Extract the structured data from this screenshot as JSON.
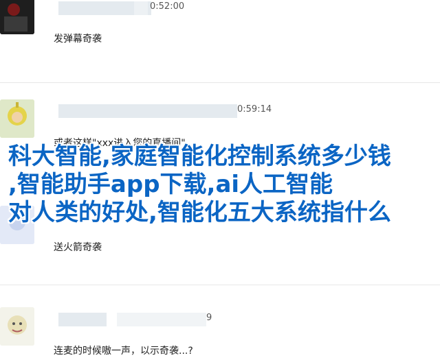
{
  "messages": [
    {
      "time": "0:52:00",
      "text": "发弹幕奇袭"
    },
    {
      "time": "0:59:14",
      "text": "或者这样\"xxx进入您的直播间\""
    },
    {
      "time": "",
      "text": "送火箭奇袭"
    },
    {
      "time": "9",
      "text": "连麦的时候嗷一声，以示奇袭...?"
    }
  ],
  "overlay": {
    "line1": "科大智能,家庭智能化控制系统多少钱",
    "line2": ",智能助手app下载,ai人工智能",
    "line3": "对人类的好处,智能化五大系统指什么"
  },
  "colors": {
    "overlay_text": "#0b65c4",
    "meta_bar": "#dfe6ec"
  }
}
